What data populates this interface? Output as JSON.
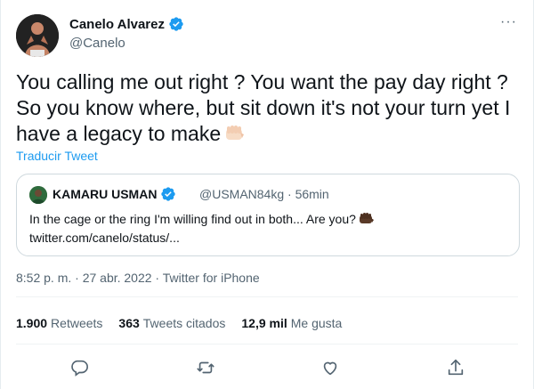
{
  "author": {
    "name": "Canelo Alvarez",
    "handle": "@Canelo"
  },
  "more_label": "···",
  "tweet_text": "You calling me out right ? You want the pay day right ? So you know where, but sit down it's not your turn yet I have a legacy to make",
  "translate_label": "Traducir Tweet",
  "quote": {
    "name": "KAMARU USMAN",
    "handle_time": "@USMAN84kg · 56min",
    "text": "In the cage or the ring I'm willing find out in both... Are you?",
    "link": "twitter.com/canelo/status/..."
  },
  "meta": "8:52 p. m. · 27 abr. 2022 · Twitter for iPhone",
  "stats": [
    {
      "count": "1.900",
      "label": "Retweets"
    },
    {
      "count": "363",
      "label": "Tweets citados"
    },
    {
      "count": "12,9 mil",
      "label": "Me gusta"
    }
  ],
  "icons": {
    "verified": "verified-badge-icon",
    "reply": "reply-icon",
    "retweet": "retweet-icon",
    "like": "like-icon",
    "share": "share-icon",
    "fist": "fist-emoji-icon"
  },
  "colors": {
    "accent": "#1d9bf0",
    "secondary_text": "#536471",
    "border": "#cfd9de"
  }
}
